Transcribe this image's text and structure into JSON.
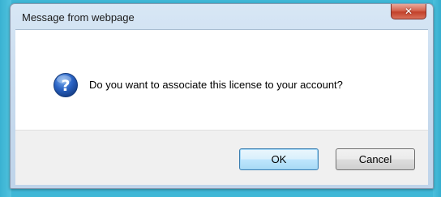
{
  "dialog": {
    "title": "Message from webpage",
    "message": "Do you want to associate this license to your account?",
    "icon": "question-icon",
    "close_glyph": "✕"
  },
  "buttons": {
    "ok_label": "OK",
    "cancel_label": "Cancel"
  },
  "colors": {
    "backdrop": "#3fb7d6",
    "close_button": "#c2412b",
    "question_icon": "#2a5fb3"
  }
}
